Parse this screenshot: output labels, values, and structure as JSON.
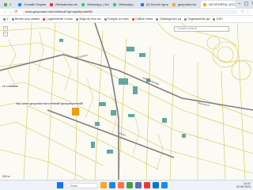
{
  "browser": {
    "tabs": [
      {
        "label": "2",
        "color": "#4caf50"
      },
      {
        "label": "Онлайн Переводчик",
        "color": "#1e88e5"
      },
      {
        "label": "Rebtrabotna ziek",
        "color": "#e53935"
      },
      {
        "label": "WhatsApp | Зеленая",
        "color": "#25d366"
      },
      {
        "label": "WhatsApp",
        "color": "#25d366"
      },
      {
        "label": "(3) Scorch ligna",
        "color": "#1877f2"
      },
      {
        "label": "geoportal.md",
        "color": "#f9a825"
      }
    ],
    "active_tab": {
      "label": "GEOPORTAL.ECO.MD",
      "color": "#f9a825"
    },
    "address": "www.geoportal.md/ru/default/?geospetiportal/86",
    "bookmarks": [
      {
        "label": "2",
        "color": "#4caf50"
      },
      {
        "label": "Bmose rpoc-adtabu",
        "color": "#888"
      },
      {
        "label": "Lugarimiente d Jonic",
        "color": "#e53935"
      },
      {
        "label": "Bogo dz:mon mv",
        "color": "#888"
      },
      {
        "label": "Ruegue un reset",
        "color": "#888"
      },
      {
        "label": "Celifiotl minec",
        "color": "#e65100"
      },
      {
        "label": "Obeziegunzio pa",
        "color": "#888"
      },
      {
        "label": "Подпишитесь да",
        "color": "#888"
      },
      {
        "label": "DJEI",
        "color": "#888"
      }
    ]
  },
  "map": {
    "search_placeholder": "Cautare adresa",
    "url_label": "http://www.geoportal.md/ru/default/?geospetiportal/86",
    "left_label": "ce coawatan",
    "scale_text": "200 m",
    "street_labels": [
      "Митр. Варлаам",
      "Ион Крянгэ",
      "Улица",
      "Мунчешть"
    ],
    "zoom_in": "+",
    "zoom_out": "−"
  },
  "taskbar": {
    "search_placeholder": "Поиск",
    "icons": [
      "#f9a825",
      "#1e88e5",
      "#ff7043",
      "#43a047",
      "#5c6bc0",
      "#e53935",
      "#0078d4",
      "#1e88e5"
    ],
    "time": "12:47",
    "date": "02.06.2023",
    "lang": "RUS"
  }
}
